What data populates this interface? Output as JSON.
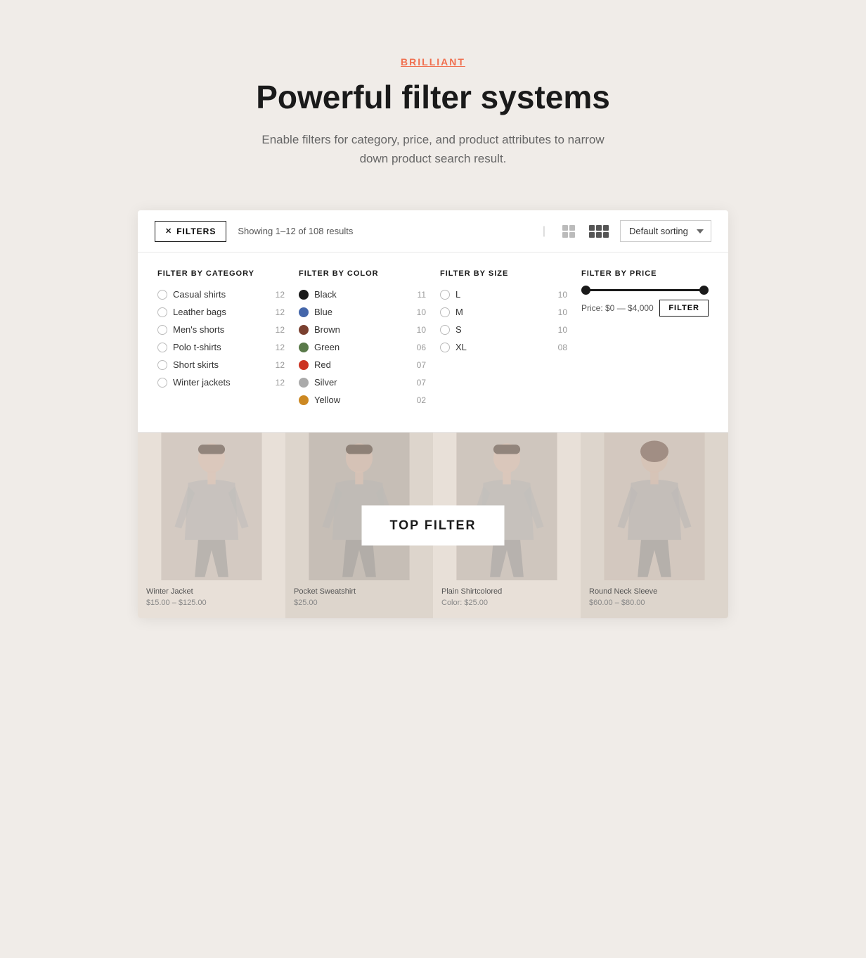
{
  "header": {
    "label": "BRILLIANT",
    "title": "Powerful filter systems",
    "description": "Enable filters for category, price, and product attributes to narrow down product search result."
  },
  "toolbar": {
    "filters_btn": "FILTERS",
    "results_text": "Showing 1–12 of 108 results",
    "sort_default": "Default sorting"
  },
  "filters": {
    "category": {
      "title": "Filter by category",
      "items": [
        {
          "label": "Casual shirts",
          "count": "12"
        },
        {
          "label": "Leather bags",
          "count": "12"
        },
        {
          "label": "Men's shorts",
          "count": "12"
        },
        {
          "label": "Polo t-shirts",
          "count": "12"
        },
        {
          "label": "Short skirts",
          "count": "12"
        },
        {
          "label": "Winter jackets",
          "count": "12"
        }
      ]
    },
    "color": {
      "title": "Filter by color",
      "items": [
        {
          "label": "Black",
          "count": "11",
          "color": "#1a1a1a"
        },
        {
          "label": "Blue",
          "count": "10",
          "color": "#4466aa"
        },
        {
          "label": "Brown",
          "count": "10",
          "color": "#7a4030"
        },
        {
          "label": "Green",
          "count": "06",
          "color": "#5a7a4a"
        },
        {
          "label": "Red",
          "count": "07",
          "color": "#cc3322"
        },
        {
          "label": "Silver",
          "count": "07",
          "color": "#aaaaaa"
        },
        {
          "label": "Yellow",
          "count": "02",
          "color": "#cc8822"
        }
      ]
    },
    "size": {
      "title": "Filter by size",
      "items": [
        {
          "label": "L",
          "count": "10"
        },
        {
          "label": "M",
          "count": "10"
        },
        {
          "label": "S",
          "count": "10"
        },
        {
          "label": "XL",
          "count": "08"
        }
      ]
    },
    "price": {
      "title": "Filter by price",
      "range_text": "Price: $0 — $4,000",
      "filter_btn": "FILTER"
    }
  },
  "products": [
    {
      "name": "Winter Jacket",
      "price": "$15.00 – $125.00"
    },
    {
      "name": "Pocket Sweatshirt",
      "price": "$25.00"
    },
    {
      "name": "Plain Shirtcolored",
      "price": "Color: $25.00"
    },
    {
      "name": "Round Neck Sleeve",
      "price": "$60.00 – $80.00"
    }
  ],
  "top_filter_label": "TOP FILTER"
}
